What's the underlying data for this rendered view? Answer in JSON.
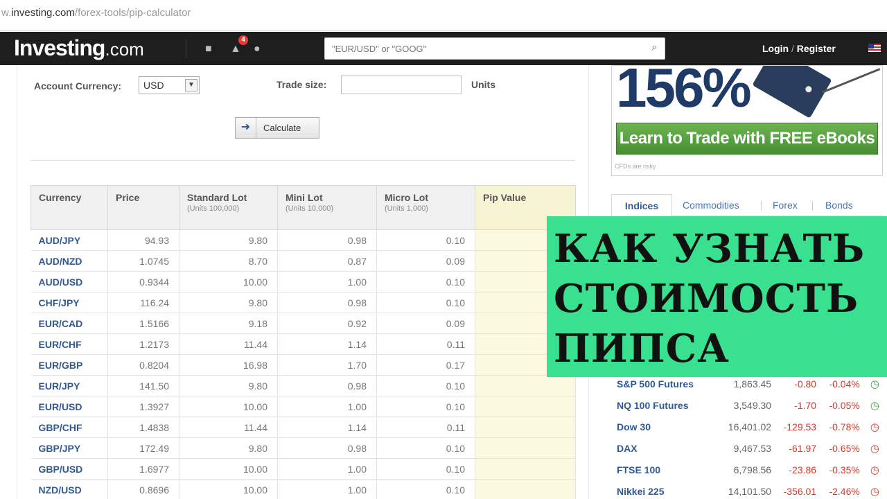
{
  "browser": {
    "url_prefix": "w.",
    "url_domain": "investing.com",
    "url_path": "/forex-tools/pip-calculator"
  },
  "header": {
    "logo_text": "Investing",
    "logo_suffix": ".com",
    "notification_count": "4",
    "search_placeholder": "\"EUR/USD\" or \"GOOG\"",
    "login_label": "Login",
    "register_label": "Register",
    "separator": "/"
  },
  "calculator": {
    "account_currency_label": "Account Currency:",
    "account_currency_value": "USD",
    "trade_size_label": "Trade size:",
    "trade_size_value": "",
    "units_label": "Units",
    "calculate_label": "Calculate"
  },
  "pip_table": {
    "headers": [
      {
        "title": "Currency",
        "sub": ""
      },
      {
        "title": "Price",
        "sub": ""
      },
      {
        "title": "Standard Lot",
        "sub": "(Units 100,000)"
      },
      {
        "title": "Mini Lot",
        "sub": "(Units 10,000)"
      },
      {
        "title": "Micro Lot",
        "sub": "(Units 1,000)"
      },
      {
        "title": "Pip Value",
        "sub": ""
      }
    ],
    "rows": [
      {
        "pair": "AUD/JPY",
        "price": "94.93",
        "standard": "9.80",
        "mini": "0.98",
        "micro": "0.10",
        "pip": ""
      },
      {
        "pair": "AUD/NZD",
        "price": "1.0745",
        "standard": "8.70",
        "mini": "0.87",
        "micro": "0.09",
        "pip": ""
      },
      {
        "pair": "AUD/USD",
        "price": "0.9344",
        "standard": "10.00",
        "mini": "1.00",
        "micro": "0.10",
        "pip": ""
      },
      {
        "pair": "CHF/JPY",
        "price": "116.24",
        "standard": "9.80",
        "mini": "0.98",
        "micro": "0.10",
        "pip": ""
      },
      {
        "pair": "EUR/CAD",
        "price": "1.5166",
        "standard": "9.18",
        "mini": "0.92",
        "micro": "0.09",
        "pip": ""
      },
      {
        "pair": "EUR/CHF",
        "price": "1.2173",
        "standard": "11.44",
        "mini": "1.14",
        "micro": "0.11",
        "pip": ""
      },
      {
        "pair": "EUR/GBP",
        "price": "0.8204",
        "standard": "16.98",
        "mini": "1.70",
        "micro": "0.17",
        "pip": ""
      },
      {
        "pair": "EUR/JPY",
        "price": "141.50",
        "standard": "9.80",
        "mini": "0.98",
        "micro": "0.10",
        "pip": ""
      },
      {
        "pair": "EUR/USD",
        "price": "1.3927",
        "standard": "10.00",
        "mini": "1.00",
        "micro": "0.10",
        "pip": ""
      },
      {
        "pair": "GBP/CHF",
        "price": "1.4838",
        "standard": "11.44",
        "mini": "1.14",
        "micro": "0.11",
        "pip": ""
      },
      {
        "pair": "GBP/JPY",
        "price": "172.49",
        "standard": "9.80",
        "mini": "0.98",
        "micro": "0.10",
        "pip": ""
      },
      {
        "pair": "GBP/USD",
        "price": "1.6977",
        "standard": "10.00",
        "mini": "1.00",
        "micro": "0.10",
        "pip": ""
      },
      {
        "pair": "NZD/USD",
        "price": "0.8696",
        "standard": "10.00",
        "mini": "1.00",
        "micro": "0.10",
        "pip": ""
      }
    ]
  },
  "ad": {
    "headline": "156%",
    "cta": "Learn to Trade with FREE eBooks",
    "disclaimer": "CFDs are risky"
  },
  "market_tabs": [
    "Indices",
    "Commodities",
    "Forex",
    "Bonds"
  ],
  "indices": [
    {
      "name": "S&P 500 Futures",
      "price": "1,863.45",
      "change": "-0.80",
      "change_pct": "-0.04%",
      "status": "open"
    },
    {
      "name": "NQ 100 Futures",
      "price": "3,549.30",
      "change": "-1.70",
      "change_pct": "-0.05%",
      "status": "open"
    },
    {
      "name": "Dow 30",
      "price": "16,401.02",
      "change": "-129.53",
      "change_pct": "-0.78%",
      "status": "closed"
    },
    {
      "name": "DAX",
      "price": "9,467.53",
      "change": "-61.97",
      "change_pct": "-0.65%",
      "status": "closed"
    },
    {
      "name": "FTSE 100",
      "price": "6,798.56",
      "change": "-23.86",
      "change_pct": "-0.35%",
      "status": "closed"
    },
    {
      "name": "Nikkei 225",
      "price": "14,101.50",
      "change": "-356.01",
      "change_pct": "-2.46%",
      "status": "closed"
    }
  ],
  "banner": {
    "line1": "КАК УЗНАТЬ",
    "line2": "СТОИМОСТЬ",
    "line3": "ПИПСА"
  }
}
